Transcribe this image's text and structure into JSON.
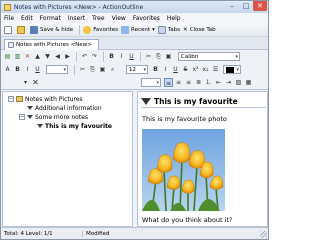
{
  "window": {
    "title": "Notes with Pictures <New> - ActionOutline"
  },
  "menu": [
    "File",
    "Edit",
    "Format",
    "Insert",
    "Tree",
    "View",
    "Favorites",
    "Help"
  ],
  "toolbar": {
    "save_hide": "Save & hide",
    "favorites": "Favorites",
    "recent": "Recent",
    "tabs": "Tabs",
    "close_tab": "Close Tab"
  },
  "tab": {
    "label": "Notes with Pictures <New>"
  },
  "format": {
    "font": "Calibri",
    "size": "12"
  },
  "tree": {
    "items": [
      {
        "label": "Notes with Pictures"
      },
      {
        "label": "Additional information"
      },
      {
        "label": "Some more notes"
      },
      {
        "label": "This is my favourite"
      }
    ]
  },
  "note": {
    "title": "This is my favourite",
    "line1": "This is my favourite photo",
    "line2": "What do you think about it?"
  },
  "status": {
    "level": "Total: 4 Level: 1/1",
    "state": "Modified"
  },
  "colors": {
    "accent": "#2e5c9b",
    "close": "#d9554a"
  }
}
